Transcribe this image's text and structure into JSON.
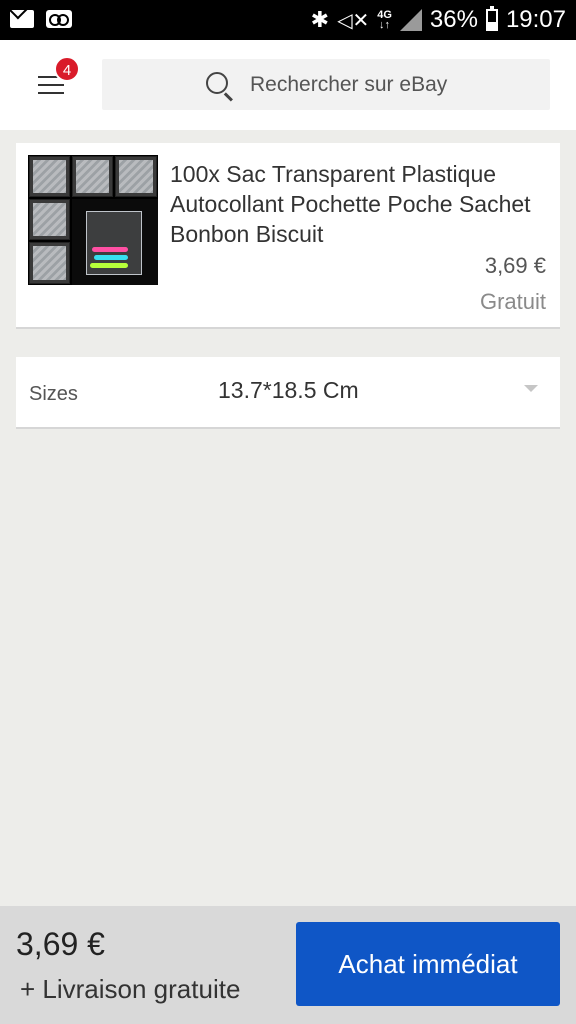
{
  "status_bar": {
    "battery_percent": "36%",
    "time": "19:07",
    "network": "4G",
    "icons": [
      "mail-icon",
      "voicemail-icon",
      "bluetooth-icon",
      "mute-icon",
      "network-4g-icon",
      "signal-icon",
      "battery-icon"
    ]
  },
  "header": {
    "menu_badge": "4",
    "search_placeholder": "Rechercher sur eBay",
    "icons": [
      "menu-icon",
      "search-icon"
    ]
  },
  "product": {
    "title": "100x Sac Transparent Plastique Autocollant Pochette Poche Sachet Bonbon Biscuit",
    "price": "3,69 €",
    "shipping": "Gratuit"
  },
  "variation": {
    "label": "Sizes",
    "selected": "13.7*18.5 Cm"
  },
  "bottom_bar": {
    "price": "3,69 €",
    "shipping": "+ Livraison gratuite",
    "buy_label": "Achat immédiat"
  },
  "colors": {
    "buy_button": "#0f56c6",
    "badge": "#d91b2a",
    "background": "#ededea"
  }
}
